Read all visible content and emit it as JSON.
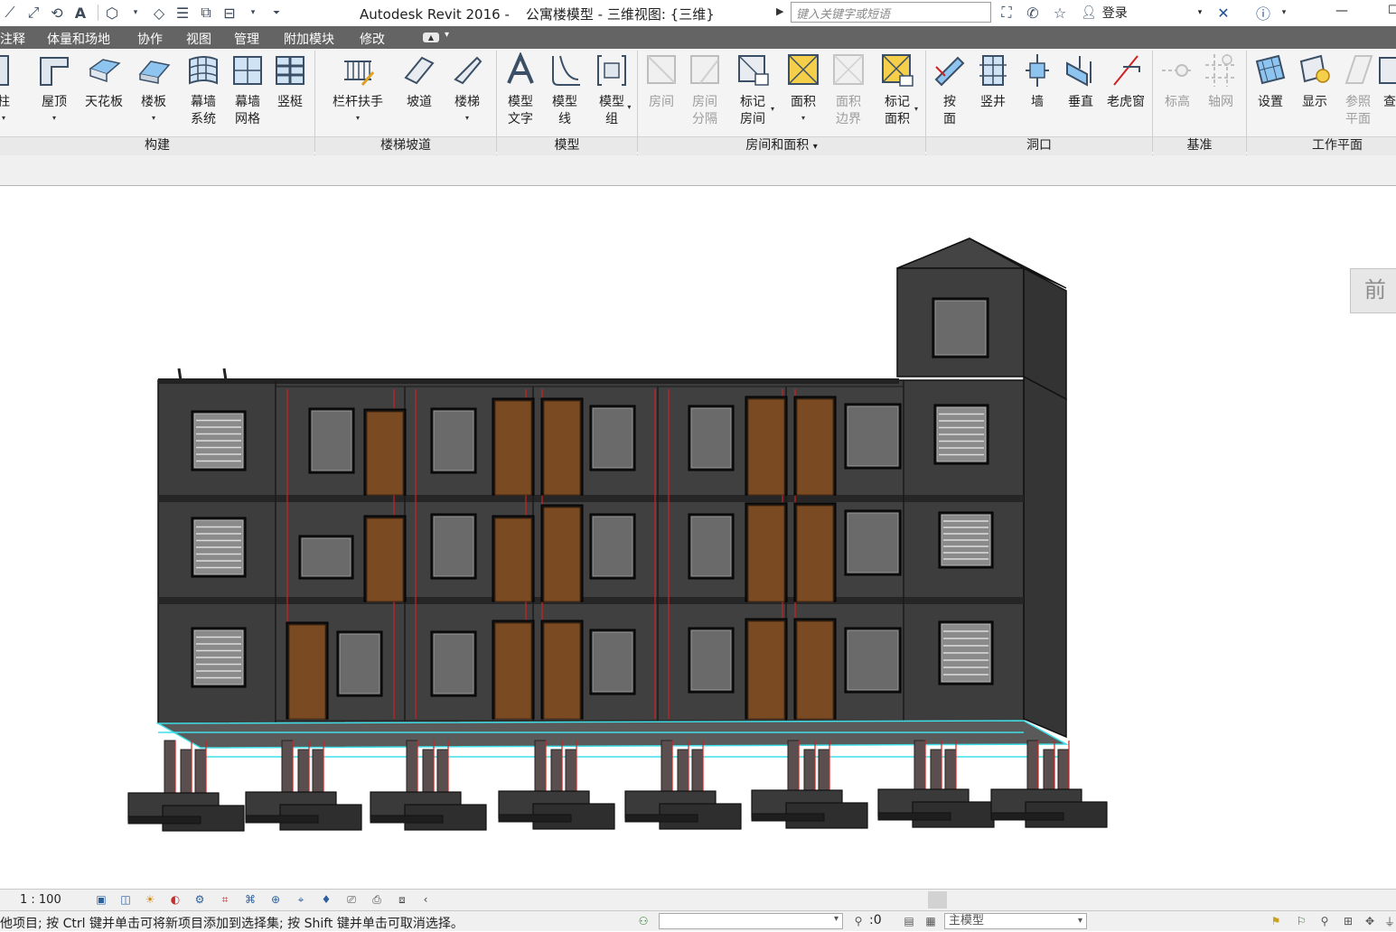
{
  "titlebar": {
    "app_name": "Autodesk Revit 2016 -",
    "document_title": "公寓楼模型 - 三维视图: {三维}",
    "search_placeholder": "键入关键字或短语",
    "login_label": "登录"
  },
  "menu_tabs": [
    "注释",
    "体量和场地",
    "协作",
    "视图",
    "管理",
    "附加模块",
    "修改"
  ],
  "ribbon": {
    "build": {
      "title": "构建",
      "buttons": [
        "柱",
        "屋顶",
        "天花板",
        "楼板",
        "幕墙\n系统",
        "幕墙\n网格",
        "竖梃"
      ]
    },
    "stairs": {
      "title": "楼梯坡道",
      "buttons": [
        "栏杆扶手",
        "坡道",
        "楼梯"
      ]
    },
    "model": {
      "title": "模型",
      "buttons": [
        "模型\n文字",
        "模型\n线",
        "模型\n组"
      ]
    },
    "room": {
      "title": "房间和面积",
      "buttons": [
        "房间",
        "房间\n分隔",
        "标记\n房间",
        "面积",
        "面积\n边界",
        "标记\n面积"
      ]
    },
    "opening": {
      "title": "洞口",
      "buttons": [
        "按\n面",
        "竖井",
        "墙",
        "垂直",
        "老虎窗"
      ]
    },
    "datum": {
      "title": "基准",
      "buttons": [
        "标高",
        "轴网"
      ]
    },
    "workplane": {
      "title": "工作平面",
      "buttons": [
        "设置",
        "显示",
        "参照\n平面",
        "查"
      ]
    }
  },
  "viewcube_label": "前",
  "viewbar": {
    "scale": "1 : 100"
  },
  "statusbar": {
    "message": "他项目; 按 Ctrl 键并单击可将新项目添加到选择集; 按 Shift 键并单击可取消选择。",
    "selection_count": ":0",
    "model_name": "主模型"
  },
  "colors": {
    "menubar": "#646464",
    "ribbon_bg": "#f4f4f4",
    "wall": "#3d3d3d",
    "door": "#7a4a23",
    "window_glass": "#6a6a6a",
    "beam_outline": "#3fe0e8",
    "column_line": "#d02020"
  }
}
